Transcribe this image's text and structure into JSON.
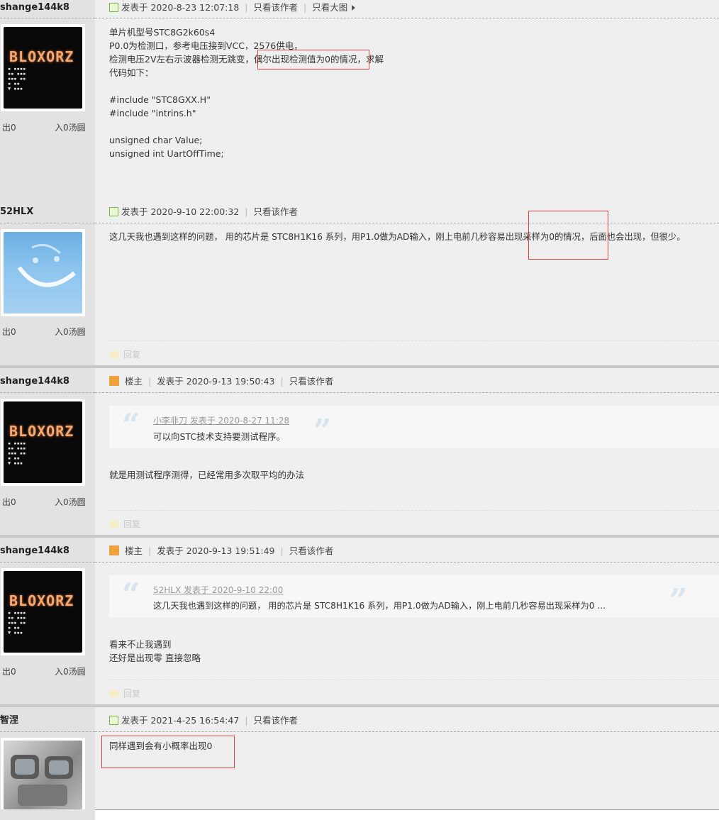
{
  "posts": [
    {
      "username": "shange144k8",
      "stat_a": "出0",
      "stat_b": "入0汤圆",
      "meta": {
        "posted": "发表于 2020-8-23 12:07:18",
        "author_only": "只看该作者",
        "big_img": "只看大图"
      },
      "body": "单片机型号STC8G2k60s4\nP0.0为检测口，参考电压接到VCC，2576供电，\n检测电压2V左右示波器检测无跳变，偶尔出现检测值为0的情况，求解\n代码如下：\n\n#include \"STC8GXX.H\"\n#include \"intrins.h\"\n\nunsigned char Value;\nunsigned int UartOffTime;"
    },
    {
      "username": "52HLX",
      "stat_a": "出0",
      "stat_b": "入0汤圆",
      "meta": {
        "posted": "发表于 2020-9-10 22:00:32",
        "author_only": "只看该作者"
      },
      "body": "这几天我也遇到这样的问题， 用的芯片是 STC8H1K16 系列，用P1.0做为AD输入，刚上电前几秒容易出现采样为0的情况，后面也会出现，但很少。",
      "reply": "回复"
    },
    {
      "username": "shange144k8",
      "stat_a": "出0",
      "stat_b": "入0汤圆",
      "meta": {
        "owner": "楼主",
        "posted": "发表于 2020-9-13 19:50:43",
        "author_only": "只看该作者"
      },
      "quote_head": "小李非刀 发表于 2020-8-27 11:28",
      "quote_text": "可以向STC技术支持要测试程序。",
      "body": "就是用测试程序测得，已经常用多次取平均的办法",
      "reply": "回复"
    },
    {
      "username": "shange144k8",
      "stat_a": "出0",
      "stat_b": "入0汤圆",
      "meta": {
        "owner": "楼主",
        "posted": "发表于 2020-9-13 19:51:49",
        "author_only": "只看该作者"
      },
      "quote_head": "52HLX 发表于 2020-9-10 22:00",
      "quote_text": "这几天我也遇到这样的问题， 用的芯片是 STC8H1K16 系列，用P1.0做为AD输入，刚上电前几秒容易出现采样为0 ...",
      "body": "看来不止我遇到\n还好是出现零 直接忽略",
      "reply": "回复"
    },
    {
      "username": "智涅",
      "meta": {
        "posted": "发表于 2021-4-25 16:54:47",
        "author_only": "只看该作者"
      },
      "body": "同样遇到会有小概率出现0"
    }
  ],
  "avatar_logo": "BLOXORZ",
  "icons": {
    "post": "post-icon",
    "owner": "owner-icon",
    "reply": "reply-bubble-icon",
    "arrow": "play-arrow-icon"
  },
  "colors": {
    "highlight_box": "#dd4444",
    "sidebar": "#e2e2e2",
    "content_bg": "#efefef"
  }
}
